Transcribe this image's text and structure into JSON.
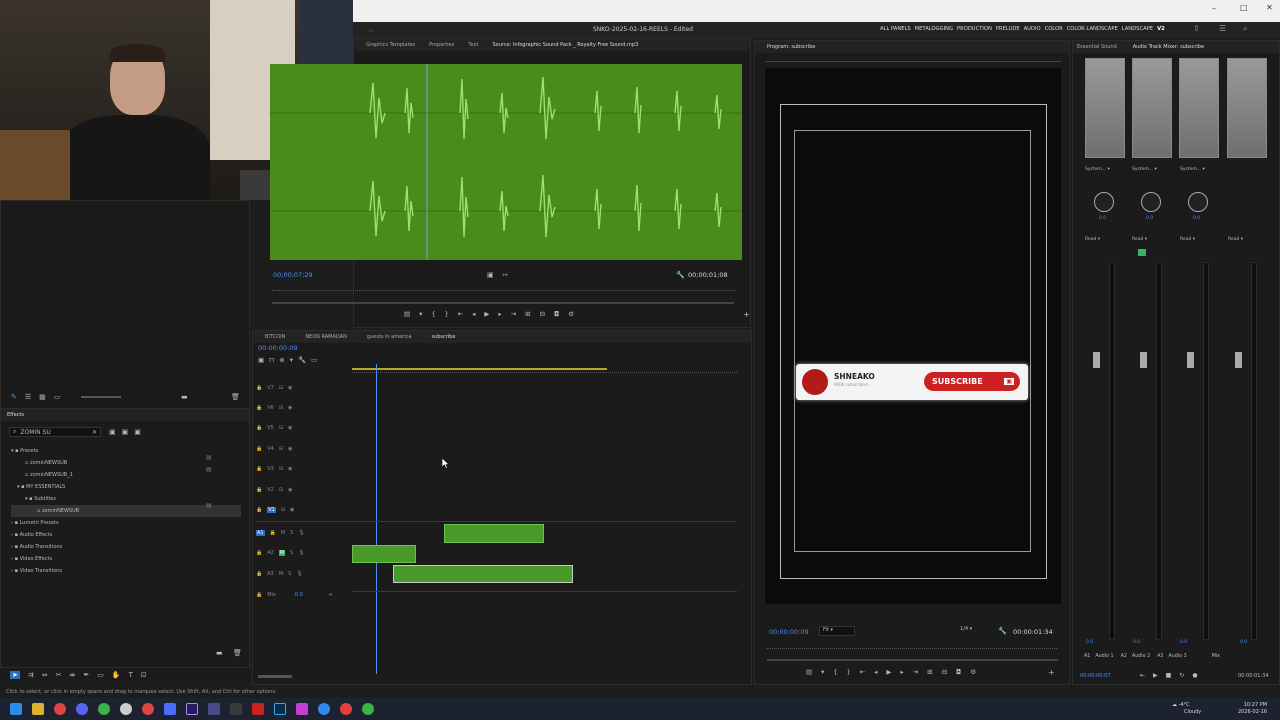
{
  "window": {
    "title": "SNKO-2025-02-16-REELS - Edited"
  },
  "workspaces": [
    "ALL PANELS",
    "METALOGGING",
    "PRODUCTION",
    "PRELUDE",
    "AUDIO",
    "COLOR",
    "COLOR LANDSCAPE",
    "LANDSCAPE",
    "V2"
  ],
  "source_tabs": [
    "Graphics Templates",
    "Properties",
    "Text",
    "Source: Infographic Sound Pack _ Royalty Free Sound.mp3"
  ],
  "source": {
    "timecode_in": "00;00;07;29",
    "timecode_out": "00;00;01;08"
  },
  "program": {
    "tab": "Program: subscribe",
    "timecode": "00:00:00:09",
    "fit": "Fit",
    "quality": "1/4",
    "duration": "00:00:01:34"
  },
  "overlay": {
    "channel": "SHNEAKO",
    "subs": "900K subscribers",
    "button": "SUBSCRIBE"
  },
  "audio_tabs": [
    "Essential Sound",
    "Audio Track Mixer: subscribe"
  ],
  "mixer": {
    "channels": [
      "A1",
      "A2",
      "A3",
      "Mix"
    ],
    "channel_names": [
      "Audio 1",
      "Audio 2",
      "Audio 3",
      "Mix"
    ],
    "input": "System...",
    "read": "Read",
    "vals": [
      "0.0",
      "0.0",
      "0.0",
      "0.0"
    ],
    "time": "00:00:00:07",
    "end_time": "00:00:01:34"
  },
  "effects": {
    "title": "Effects",
    "search": "ZOMIN SU",
    "tree": [
      "Presets",
      "zominNEWSUB",
      "zominNEWSUB_1",
      "MY ESSENTIALS",
      "Subtitles",
      "zominNEWSUB",
      "Lumetri Presets",
      "Audio Effects",
      "Audio Transitions",
      "Video Effects",
      "Video Transitions"
    ]
  },
  "timeline": {
    "tabs": [
      "BITCOIN",
      "NEON RAMADAN",
      "guests in america",
      "subscribe"
    ],
    "timecode": "00:00:00:09",
    "video_tracks": [
      "V7",
      "V6",
      "V5",
      "V4",
      "V3",
      "V2",
      "V1"
    ],
    "audio_tracks": [
      "A1",
      "A2",
      "A3"
    ],
    "mix": "Mix",
    "mix_val": "0.0"
  },
  "status": "Click to select, or click in empty space and drag to marquee select. Use Shift, Alt, and Ctrl for other options.",
  "tray": {
    "weather": "-4°C",
    "weather_sub": "Cloudy",
    "time": "10:27 PM",
    "date": "2026-02-16"
  },
  "colors": {
    "accent": "#2d8ceb",
    "waveform": "#5ca02a",
    "subscribe": "#cc1f1f"
  }
}
